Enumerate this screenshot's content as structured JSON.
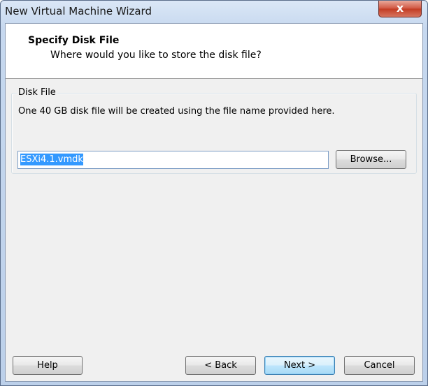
{
  "window": {
    "title": "New Virtual Machine Wizard",
    "close_glyph": "x"
  },
  "header": {
    "title": "Specify Disk File",
    "subtitle": "Where would you like to store the disk file?"
  },
  "disk_file": {
    "group_label": "Disk File",
    "description": "One 40 GB disk file will be created using the file name provided here.",
    "file_name": "ESXi4.1.vmdk",
    "browse_label": "Browse..."
  },
  "footer": {
    "help_label": "Help",
    "back_label": "< Back",
    "next_label": "Next >",
    "cancel_label": "Cancel"
  }
}
